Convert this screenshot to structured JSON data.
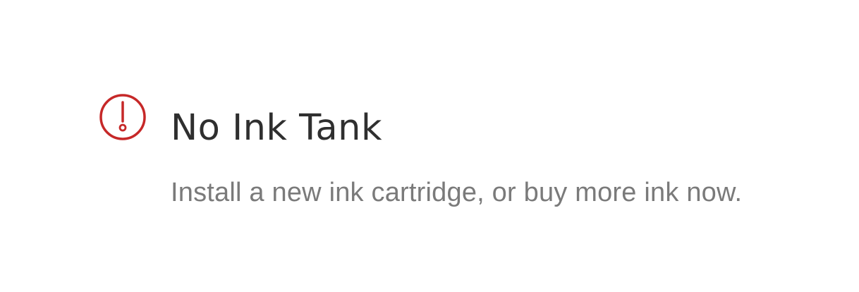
{
  "alert": {
    "icon": "exclamation-circle-icon",
    "icon_color": "#c62828",
    "title": "No Ink Tank",
    "message": "Install a new ink cartridge, or buy more ink now."
  },
  "colors": {
    "title": "#2f2f2f",
    "message": "#7a7a7a",
    "background": "#ffffff"
  }
}
